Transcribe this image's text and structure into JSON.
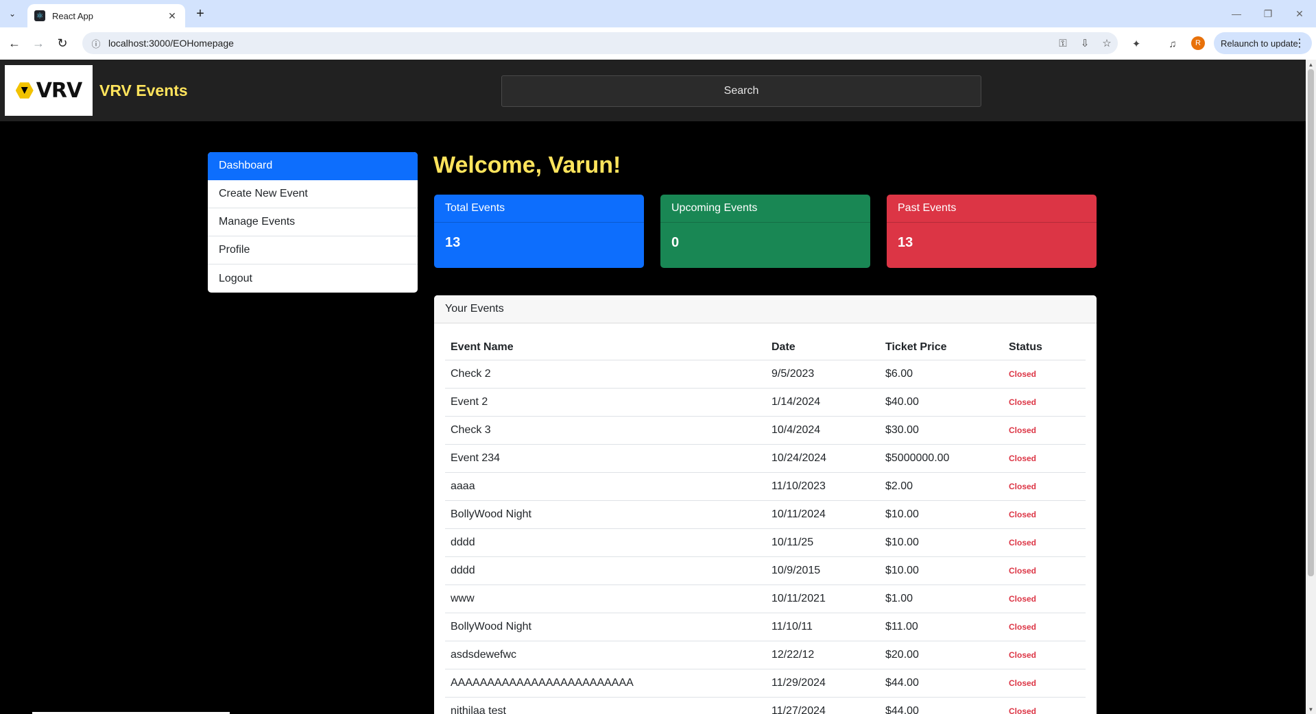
{
  "browser": {
    "tab_title": "React App",
    "url": "localhost:3000/EOHomepage",
    "relaunch_label": "Relaunch to update",
    "profile_initial": "R"
  },
  "header": {
    "logo_text": "VRV",
    "brand": "VRV Events",
    "search_placeholder": "Search"
  },
  "sidebar": {
    "items": [
      {
        "label": "Dashboard"
      },
      {
        "label": "Create New Event"
      },
      {
        "label": "Manage Events"
      },
      {
        "label": "Profile"
      },
      {
        "label": "Logout"
      }
    ]
  },
  "main": {
    "welcome": "Welcome, Varun!",
    "stats": [
      {
        "label": "Total Events",
        "value": "13",
        "color": "#0d6efd"
      },
      {
        "label": "Upcoming Events",
        "value": "0",
        "color": "#198754"
      },
      {
        "label": "Past Events",
        "value": "13",
        "color": "#dc3545"
      }
    ],
    "events_title": "Your Events",
    "columns": [
      "Event Name",
      "Date",
      "Ticket Price",
      "Status"
    ],
    "rows": [
      {
        "name": "Check 2",
        "date": "9/5/2023",
        "price": "$6.00",
        "status": "Closed"
      },
      {
        "name": "Event 2",
        "date": "1/14/2024",
        "price": "$40.00",
        "status": "Closed"
      },
      {
        "name": "Check 3",
        "date": "10/4/2024",
        "price": "$30.00",
        "status": "Closed"
      },
      {
        "name": "Event 234",
        "date": "10/24/2024",
        "price": "$5000000.00",
        "status": "Closed"
      },
      {
        "name": "aaaa",
        "date": "11/10/2023",
        "price": "$2.00",
        "status": "Closed"
      },
      {
        "name": "BollyWood Night",
        "date": "10/11/2024",
        "price": "$10.00",
        "status": "Closed"
      },
      {
        "name": "dddd",
        "date": "10/11/25",
        "price": "$10.00",
        "status": "Closed"
      },
      {
        "name": "dddd",
        "date": "10/9/2015",
        "price": "$10.00",
        "status": "Closed"
      },
      {
        "name": "www",
        "date": "10/11/2021",
        "price": "$1.00",
        "status": "Closed"
      },
      {
        "name": "BollyWood Night",
        "date": "11/10/11",
        "price": "$11.00",
        "status": "Closed"
      },
      {
        "name": "asdsdewefwc",
        "date": "12/22/12",
        "price": "$20.00",
        "status": "Closed"
      },
      {
        "name": "AAAAAAAAAAAAAAAAAAAAAAAAA",
        "date": "11/29/2024",
        "price": "$44.00",
        "status": "Closed"
      },
      {
        "name": "nithilaa test",
        "date": "11/27/2024",
        "price": "$44.00",
        "status": "Closed"
      }
    ]
  }
}
